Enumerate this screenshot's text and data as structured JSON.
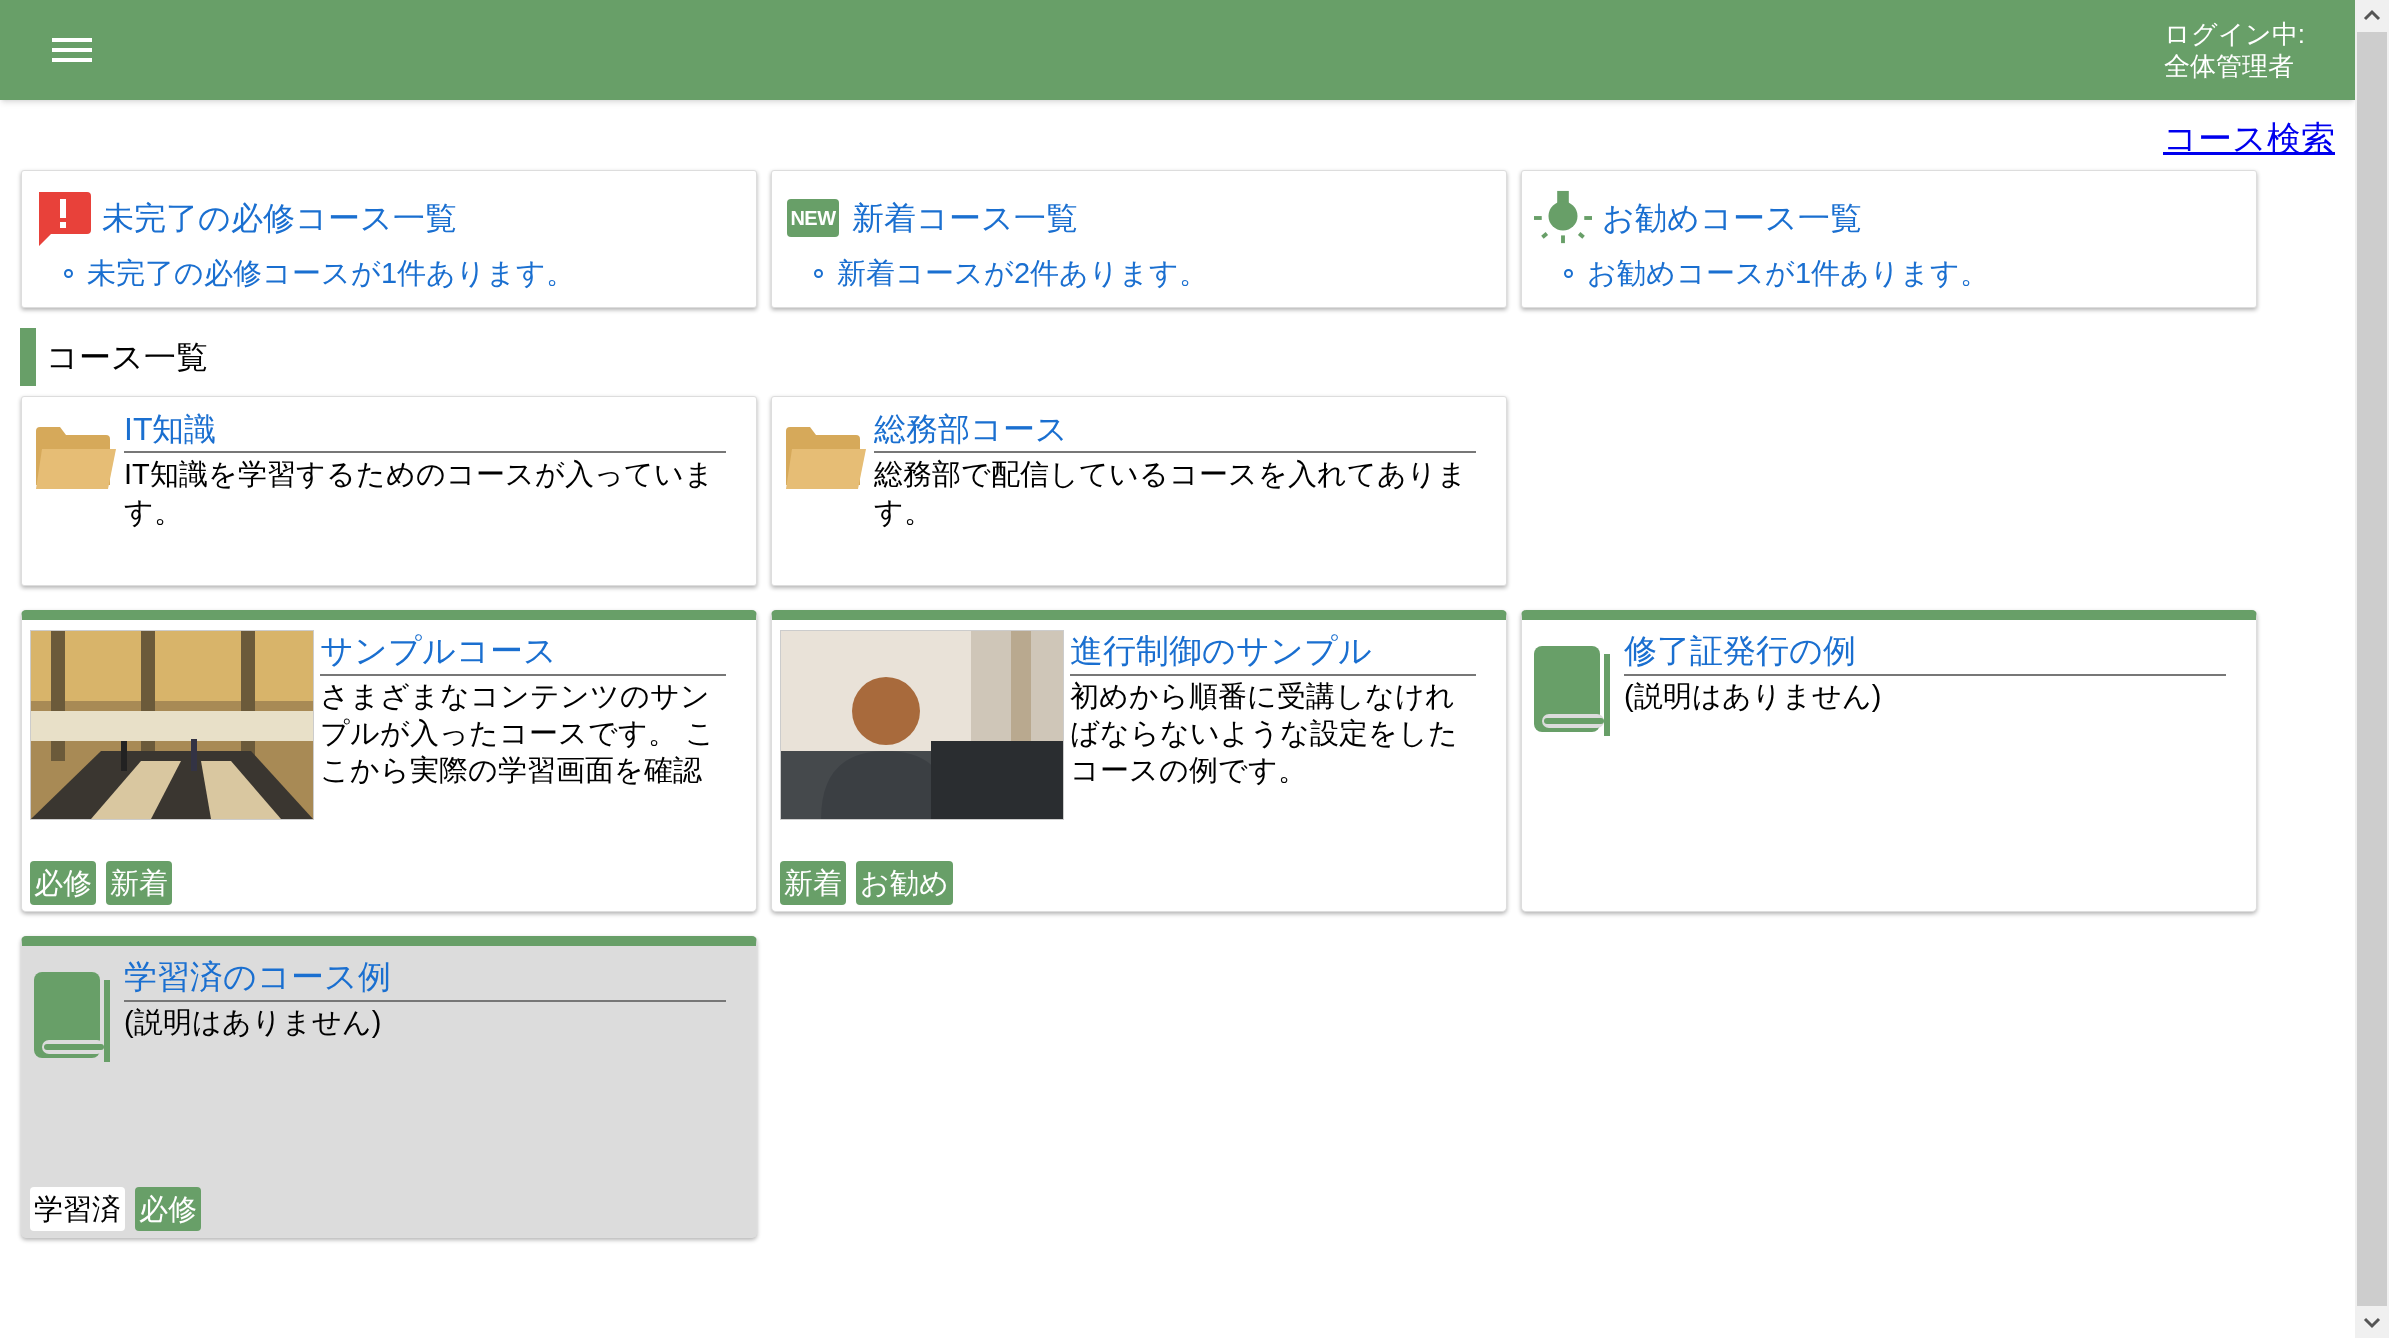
{
  "header": {
    "login_label": "ログイン中:",
    "user": "全体管理者"
  },
  "search_link": "コース検索",
  "notices": [
    {
      "kind": "required",
      "title": "未完了の必修コース一覧",
      "item": "未完了の必修コースが1件あります。"
    },
    {
      "kind": "new",
      "icon_text": "NEW",
      "title": "新着コース一覧",
      "item": "新着コースが2件あります。"
    },
    {
      "kind": "recommend",
      "title": "お勧めコース一覧",
      "item": "お勧めコースが1件あります。"
    }
  ],
  "section_title": "コース一覧",
  "folders": [
    {
      "title": "IT知識",
      "description": "IT知識を学習するためのコースが入っています。"
    },
    {
      "title": "総務部コース",
      "description": "総務部で配信しているコースを入れてあります。"
    }
  ],
  "courses": [
    {
      "title": "サンプルコース",
      "description": "さまざまなコンテンツのサンプルが入ったコースです。 ここから実際の学習画面を確認",
      "completed": false,
      "tags": [
        {
          "kind": "required",
          "label": "必修"
        },
        {
          "kind": "new",
          "label": "新着"
        }
      ]
    },
    {
      "title": "進行制御のサンプル",
      "description": "初めから順番に受講しなければならないような設定をしたコースの例です。",
      "completed": false,
      "tags": [
        {
          "kind": "new",
          "label": "新着"
        },
        {
          "kind": "recommended",
          "label": "お勧め"
        }
      ]
    },
    {
      "kind": "book",
      "title": "修了証発行の例",
      "description": "(説明はありません)",
      "completed": false
    },
    {
      "kind": "book",
      "title": "学習済のコース例",
      "description": "(説明はありません)",
      "completed": true,
      "tags": [
        {
          "kind": "completed",
          "label": "学習済"
        },
        {
          "kind": "required",
          "label": "必修"
        }
      ]
    }
  ]
}
